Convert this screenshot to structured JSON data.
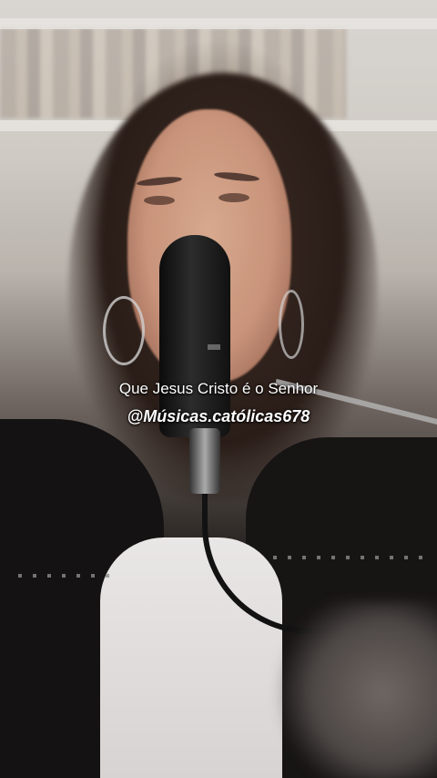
{
  "video": {
    "caption": "Que Jesus Cristo é o Senhor",
    "handle": "@Músicas.católicas678"
  }
}
